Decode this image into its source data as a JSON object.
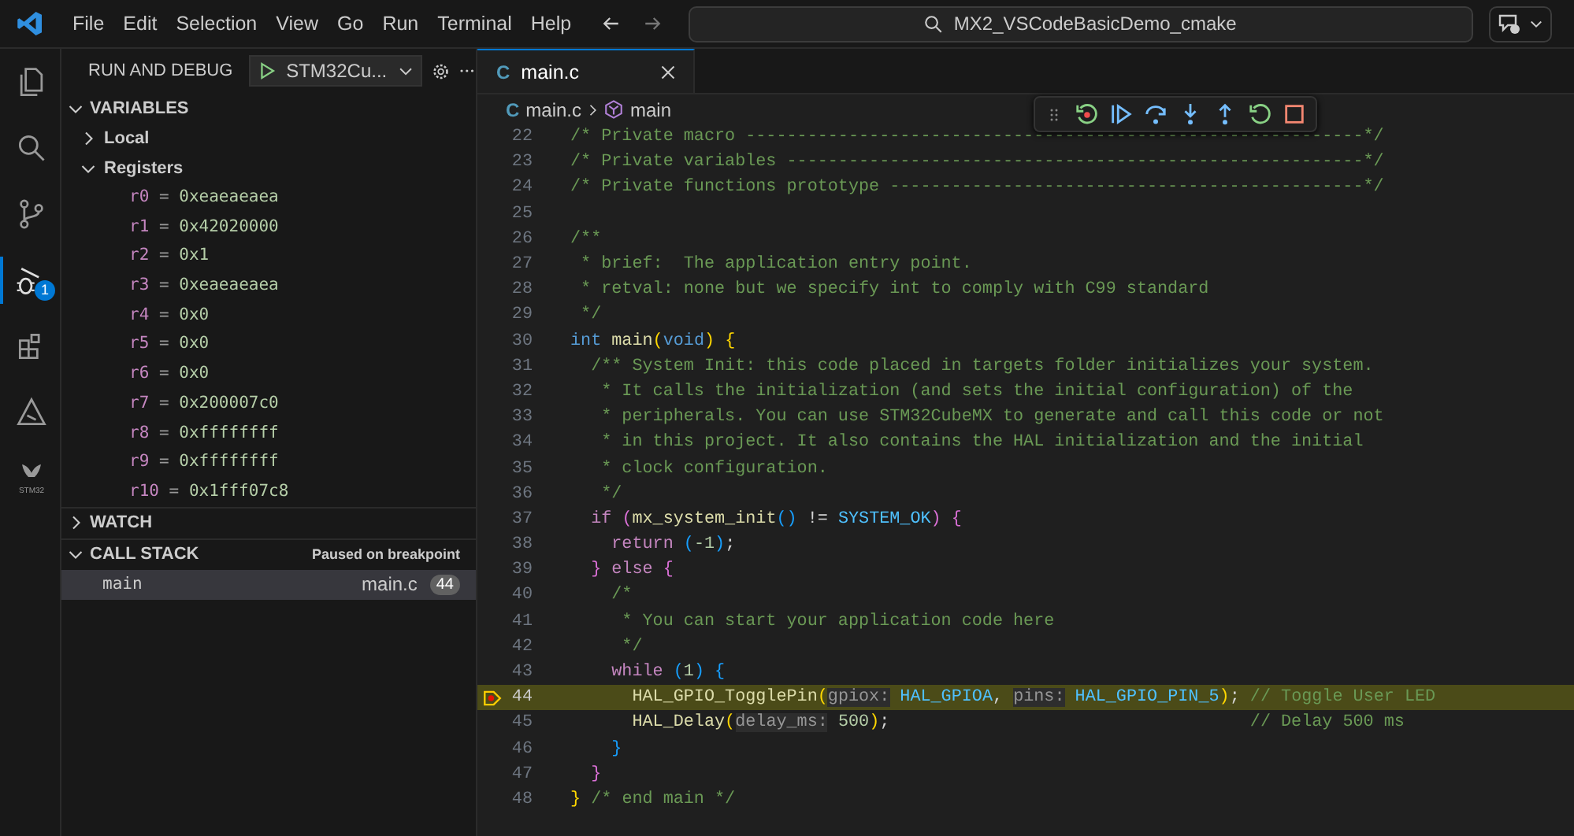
{
  "title_bar": {
    "menu": [
      "File",
      "Edit",
      "Selection",
      "View",
      "Go",
      "Run",
      "Terminal",
      "Help"
    ],
    "search": "MX2_VSCodeBasicDemo_cmake"
  },
  "activity_bar": [
    {
      "kind": "files",
      "selected": false
    },
    {
      "kind": "search",
      "selected": false
    },
    {
      "kind": "source-control",
      "selected": false
    },
    {
      "kind": "debug",
      "selected": true,
      "badge": "1"
    },
    {
      "kind": "extensions",
      "selected": false
    },
    {
      "kind": "tool",
      "selected": false
    },
    {
      "kind": "stm32",
      "selected": false,
      "label": "STM32"
    }
  ],
  "sidebar": {
    "title": "RUN AND DEBUG",
    "config": "STM32Cu...",
    "variables": {
      "title": "VARIABLES",
      "expanded": true,
      "scopes": [
        {
          "name": "Local",
          "expanded": false
        },
        {
          "name": "Registers",
          "expanded": true,
          "children": [
            {
              "name": "r0",
              "op": "=",
              "value": "0xeaeaeaea"
            },
            {
              "name": "r1",
              "op": "=",
              "value": "0x42020000"
            },
            {
              "name": "r2",
              "op": "=",
              "value": "0x1"
            },
            {
              "name": "r3",
              "op": "=",
              "value": "0xeaeaeaea"
            },
            {
              "name": "r4",
              "op": "=",
              "value": "0x0"
            },
            {
              "name": "r5",
              "op": "=",
              "value": "0x0"
            },
            {
              "name": "r6",
              "op": "=",
              "value": "0x0"
            },
            {
              "name": "r7",
              "op": "=",
              "value": "0x200007c0"
            },
            {
              "name": "r8",
              "op": "=",
              "value": "0xffffffff"
            },
            {
              "name": "r9",
              "op": "=",
              "value": "0xffffffff"
            },
            {
              "name": "r10",
              "op": "=",
              "value": "0x1fff07c8"
            }
          ]
        }
      ]
    },
    "watch": {
      "title": "WATCH",
      "expanded": false
    },
    "call_stack": {
      "title": "CALL STACK",
      "expanded": true,
      "status": "Paused on breakpoint",
      "frames": [
        {
          "name": "main",
          "file": "main.c",
          "line": "44",
          "selected": true
        }
      ]
    }
  },
  "editor": {
    "tabs": [
      {
        "icon": "C",
        "label": "main.c",
        "selected": true
      }
    ],
    "breadcrumb": [
      {
        "kind": "file",
        "icon": "C",
        "label": "main.c"
      },
      {
        "kind": "symbol",
        "label": "main"
      }
    ],
    "lines": [
      {
        "number": "22",
        "current": false,
        "tokens": [
          {
            "t": "/* Private macro ------------------------------------------------------------*/",
            "kind": "comment"
          }
        ]
      },
      {
        "number": "23",
        "current": false,
        "tokens": [
          {
            "t": "/* Private variables --------------------------------------------------------*/",
            "kind": "comment"
          }
        ]
      },
      {
        "number": "24",
        "current": false,
        "tokens": [
          {
            "t": "/* Private functions prototype ----------------------------------------------*/",
            "kind": "comment"
          }
        ]
      },
      {
        "number": "25",
        "current": false
      },
      {
        "number": "26",
        "current": false,
        "tokens": [
          {
            "t": "/**",
            "kind": "comment"
          }
        ]
      },
      {
        "number": "27",
        "current": false,
        "tokens": [
          {
            "t": " * brief:  The application entry point.",
            "kind": "comment"
          }
        ]
      },
      {
        "number": "28",
        "current": false,
        "tokens": [
          {
            "t": " * retval: none but we specify int to comply with C99 standard",
            "kind": "comment"
          }
        ]
      },
      {
        "number": "29",
        "current": false,
        "tokens": [
          {
            "t": " */",
            "kind": "comment"
          }
        ]
      },
      {
        "number": "30",
        "current": false,
        "tokens": [
          {
            "t": "int",
            "kind": "keyword"
          },
          {
            "t": " main",
            "kind": "function"
          },
          {
            "t": "(",
            "kind": "bracket1"
          },
          {
            "t": "void",
            "kind": "keyword"
          },
          {
            "t": ")",
            "kind": "bracket1"
          },
          {
            "t": " {",
            "kind": "bracket1"
          }
        ]
      },
      {
        "number": "31",
        "current": false,
        "tokens": [
          {
            "t": "  /** System Init: this code placed in targets folder initializes your system.",
            "kind": "comment"
          }
        ]
      },
      {
        "number": "32",
        "current": false,
        "tokens": [
          {
            "t": "   * It calls the initialization (and sets the initial configuration) of the",
            "kind": "comment"
          }
        ]
      },
      {
        "number": "33",
        "current": false,
        "tokens": [
          {
            "t": "   * peripherals. You can use STM32CubeMX to generate and call this code or not",
            "kind": "comment"
          }
        ]
      },
      {
        "number": "34",
        "current": false,
        "tokens": [
          {
            "t": "   * in this project. It also contains the HAL initialization and the initial",
            "kind": "comment"
          }
        ]
      },
      {
        "number": "35",
        "current": false,
        "tokens": [
          {
            "t": "   * clock configuration.",
            "kind": "comment"
          }
        ]
      },
      {
        "number": "36",
        "current": false,
        "tokens": [
          {
            "t": "   */",
            "kind": "comment"
          }
        ]
      },
      {
        "number": "37",
        "current": false,
        "tokens": [
          {
            "t": "  if",
            "kind": "control"
          },
          {
            "t": " (",
            "kind": "bracket2"
          },
          {
            "t": "mx_system_init",
            "kind": "function"
          },
          {
            "t": "()",
            "kind": "bracket3"
          },
          {
            "t": " !=",
            "kind": "plain"
          },
          {
            "t": " SYSTEM_OK",
            "kind": "macro"
          },
          {
            "t": ")",
            "kind": "bracket2"
          },
          {
            "t": " {",
            "kind": "bracket2"
          }
        ]
      },
      {
        "number": "38",
        "current": false,
        "tokens": [
          {
            "t": "    return",
            "kind": "control"
          },
          {
            "t": " (",
            "kind": "bracket3"
          },
          {
            "t": "-1",
            "kind": "number"
          },
          {
            "t": ")",
            "kind": "bracket3"
          },
          {
            "t": ";",
            "kind": "plain"
          }
        ]
      },
      {
        "number": "39",
        "current": false,
        "tokens": [
          {
            "t": "  }",
            "kind": "bracket2"
          },
          {
            "t": " else",
            "kind": "control"
          },
          {
            "t": " {",
            "kind": "bracket2"
          }
        ]
      },
      {
        "number": "40",
        "current": false,
        "tokens": [
          {
            "t": "    /*",
            "kind": "comment"
          }
        ]
      },
      {
        "number": "41",
        "current": false,
        "tokens": [
          {
            "t": "     * You can start your application code here",
            "kind": "comment"
          }
        ]
      },
      {
        "number": "42",
        "current": false,
        "tokens": [
          {
            "t": "     */",
            "kind": "comment"
          }
        ]
      },
      {
        "number": "43",
        "current": false,
        "tokens": [
          {
            "t": "    while",
            "kind": "control"
          },
          {
            "t": " (",
            "kind": "bracket3"
          },
          {
            "t": "1",
            "kind": "number"
          },
          {
            "t": ")",
            "kind": "bracket3"
          },
          {
            "t": " {",
            "kind": "bracket3"
          }
        ]
      },
      {
        "number": "44",
        "current": true,
        "tokens": [
          {
            "t": "      HAL_GPIO_TogglePin",
            "kind": "function"
          },
          {
            "t": "(",
            "kind": "bracket1"
          },
          {
            "t": "gpiox:",
            "kind": "hint"
          },
          {
            "t": " HAL_GPIOA",
            "kind": "macro"
          },
          {
            "t": ", ",
            "kind": "plain"
          },
          {
            "t": "pins:",
            "kind": "hint"
          },
          {
            "t": " HAL_GPIO_PIN_5",
            "kind": "macro"
          },
          {
            "t": ")",
            "kind": "bracket1"
          },
          {
            "t": ";",
            "kind": "plain"
          },
          {
            "t": " // Toggle User LED",
            "kind": "comment"
          }
        ]
      },
      {
        "number": "45",
        "current": false,
        "tokens": [
          {
            "t": "      HAL_Delay",
            "kind": "function"
          },
          {
            "t": "(",
            "kind": "bracket1"
          },
          {
            "t": "delay_ms:",
            "kind": "hint"
          },
          {
            "t": " 500",
            "kind": "number"
          },
          {
            "t": ")",
            "kind": "bracket1"
          },
          {
            "t": ";",
            "kind": "plain"
          },
          {
            "t": "                                   // Delay 500 ms",
            "kind": "comment"
          }
        ]
      },
      {
        "number": "46",
        "current": false,
        "tokens": [
          {
            "t": "    }",
            "kind": "bracket3"
          }
        ]
      },
      {
        "number": "47",
        "current": false,
        "tokens": [
          {
            "t": "  }",
            "kind": "bracket2"
          }
        ]
      },
      {
        "number": "48",
        "current": false,
        "tokens": [
          {
            "t": "}",
            "kind": "bracket1"
          },
          {
            "t": " /* end main */",
            "kind": "comment"
          }
        ]
      }
    ]
  }
}
